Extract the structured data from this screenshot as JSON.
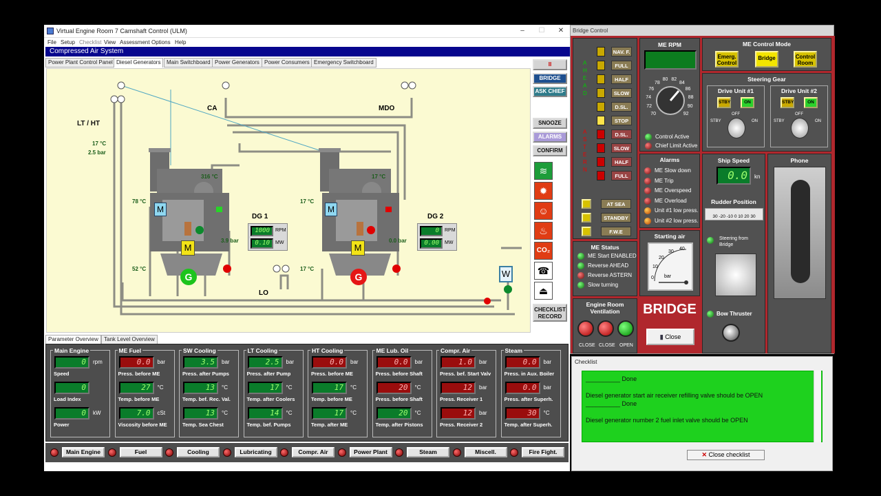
{
  "main": {
    "title": "Virtual Engine Room 7 Camshaft Control (ULM)",
    "menu": [
      "File",
      "Setup",
      "Checklist",
      "View",
      "Assessment",
      "Options",
      "Help"
    ],
    "section": "Compressed Air System",
    "tabs": [
      "Power Plant Control Panel",
      "Diesel Generators",
      "Main Switchboard",
      "Power Generators",
      "Power Consumers",
      "Emergency Switchboard"
    ],
    "diagram": {
      "lt_ht": "LT / HT",
      "ca": "CA",
      "mdo": "MDO",
      "lo": "LO",
      "lt_temp": "17 °C",
      "lt_press": "2.5 bar",
      "dg1_exh": "316 °C",
      "dg1_78": "78 °C",
      "dg1_52": "52 °C",
      "dg1_bar": "3.9 bar",
      "dg2_exh": "17 °C",
      "dg2_17a": "17 °C",
      "dg2_17b": "17 °C",
      "dg2_bar": "0.0 bar",
      "dg1": {
        "name": "DG 1",
        "rpm": "1000",
        "mw": "0.10",
        "rpm_u": "RPM",
        "mw_u": "MW"
      },
      "dg2": {
        "name": "DG 2",
        "rpm": "0",
        "mw": "0.00",
        "rpm_u": "RPM",
        "mw_u": "MW"
      },
      "m": "M",
      "g": "G",
      "w": "W"
    },
    "side": {
      "pause": "II",
      "bridge": "BRIDGE",
      "ask_chief": "ASK CHIEF",
      "snooze": "SNOOZE",
      "alarms": "ALARMS",
      "confirm": "CONFIRM",
      "checklist_record": "CHECKLIST RECORD"
    },
    "param_tabs": [
      "Parameter Overview",
      "Tank Level Overview"
    ],
    "groups": [
      {
        "title": "Main Engine",
        "rows": [
          {
            "v": "0",
            "u": "rpm",
            "l": "Speed"
          },
          {
            "v": "0",
            "u": "",
            "l": "Load Index"
          },
          {
            "v": "0",
            "u": "kW",
            "l": "Power"
          }
        ]
      },
      {
        "title": "ME Fuel",
        "rows": [
          {
            "v": "0.0",
            "u": "bar",
            "l": "Press. before ME",
            "red": true
          },
          {
            "v": "27",
            "u": "°C",
            "l": "Temp. before ME"
          },
          {
            "v": "7.0",
            "u": "cSt",
            "l": "Viscosity before ME"
          }
        ]
      },
      {
        "title": "SW Cooling",
        "rows": [
          {
            "v": "3.5",
            "u": "bar",
            "l": "Press. after Pumps"
          },
          {
            "v": "13",
            "u": "°C",
            "l": "Temp. bef. Rec. Val."
          },
          {
            "v": "13",
            "u": "°C",
            "l": "Temp. Sea Chest"
          }
        ]
      },
      {
        "title": "LT Cooling",
        "rows": [
          {
            "v": "2.5",
            "u": "bar",
            "l": "Press. after Pump"
          },
          {
            "v": "17",
            "u": "°C",
            "l": "Temp. after Coolers"
          },
          {
            "v": "14",
            "u": "°C",
            "l": "Temp. bef. Pumps"
          }
        ]
      },
      {
        "title": "HT Cooling",
        "rows": [
          {
            "v": "0.0",
            "u": "bar",
            "l": "Press. before ME",
            "red": true
          },
          {
            "v": "17",
            "u": "°C",
            "l": "Temp. before ME"
          },
          {
            "v": "17",
            "u": "°C",
            "l": "Temp. after ME"
          }
        ]
      },
      {
        "title": "ME Lub. Oil",
        "rows": [
          {
            "v": "0.0",
            "u": "bar",
            "l": "Press. before Shaft",
            "red": true
          },
          {
            "v": "20",
            "u": "°C",
            "l": "Press. before Shaft",
            "red": true
          },
          {
            "v": "20",
            "u": "°C",
            "l": "Temp. after Pistons"
          }
        ]
      },
      {
        "title": "Compr. Air",
        "rows": [
          {
            "v": "1.0",
            "u": "bar",
            "l": "Press. bef. Start Valv",
            "red": true
          },
          {
            "v": "12",
            "u": "bar",
            "l": "Press. Receiver 1",
            "red": true
          },
          {
            "v": "12",
            "u": "bar",
            "l": "Press. Receiver 2",
            "red": true
          }
        ]
      },
      {
        "title": "Steam",
        "rows": [
          {
            "v": "0.0",
            "u": "bar",
            "l": "Press. in Aux. Boiler",
            "red": true
          },
          {
            "v": "0.0",
            "u": "bar",
            "l": "Press. after Superh.",
            "red": true
          },
          {
            "v": "30",
            "u": "°C",
            "l": "Temp. after Superh.",
            "red": true
          }
        ]
      }
    ],
    "bottom_buttons": [
      "Main Engine",
      "Fuel",
      "Cooling",
      "Lubricating",
      "Compr. Air",
      "Power Plant",
      "Steam",
      "Miscell.",
      "Fire Fight."
    ]
  },
  "bridge": {
    "title": "Bridge Control",
    "telegraph": {
      "ahead": "AHEAD",
      "astern": "ASTERN",
      "labels": [
        "NAV. F.",
        "FULL",
        "HALF",
        "SLOW",
        "D.SL.",
        "STOP",
        "D.SL.",
        "SLOW",
        "HALF",
        "FULL"
      ],
      "modes": [
        "AT SEA",
        "STANDBY",
        "F.W.E"
      ]
    },
    "me_rpm": {
      "title": "ME RPM",
      "ticks": [
        "70",
        "72",
        "74",
        "76",
        "78",
        "80",
        "82",
        "84",
        "86",
        "88",
        "90",
        "92"
      ],
      "control_active": "Control Active",
      "chief_limit": "Chief Limit Active"
    },
    "control_mode": {
      "title": "ME Control Mode",
      "buttons": [
        "Emerg. Control",
        "Bridge",
        "Control Room"
      ]
    },
    "steering": {
      "title": "Steering Gear",
      "du1": "Drive Unit #1",
      "du2": "Drive Unit #2",
      "stby": "STBY",
      "on": "ON",
      "off": "OFF"
    },
    "alarms": {
      "title": "Alarms",
      "items": [
        "ME Slow down",
        "ME Trip",
        "ME Overspeed",
        "ME Overload",
        "Unit #1 low press.",
        "Unit #2 low press."
      ]
    },
    "ship_speed": {
      "title": "Ship Speed",
      "value": "0.0",
      "unit": "kn"
    },
    "rudder": {
      "title": "Rudder Position",
      "scale": "30 -20 -10 0 10 20 30"
    },
    "steering_bridge": "Steering from Bridge",
    "phone": "Phone",
    "me_status": {
      "title": "ME Status",
      "items": [
        "ME Start ENABLED",
        "Reverse AHEAD",
        "Reverse ASTERN",
        "Slow turning"
      ]
    },
    "starting_air": {
      "title": "Starting air",
      "ticks": [
        "0",
        "10",
        "20",
        "30",
        "40"
      ],
      "unit": "bar"
    },
    "ventilation": {
      "title": "Engine Room Ventilation",
      "labels": [
        "CLOSE",
        "CLOSE",
        "OPEN"
      ]
    },
    "bridge_label": "BRIDGE",
    "close": "Close",
    "bow_thruster": "Bow Thruster"
  },
  "checklist": {
    "title": "Checklist",
    "lines": [
      "__________ Done",
      "Diesel generator start air receiver refilling valve should be OPEN",
      "__________ Done",
      "Diesel generator number 2 fuel inlet valve should be OPEN"
    ],
    "close": "Close checklist"
  }
}
